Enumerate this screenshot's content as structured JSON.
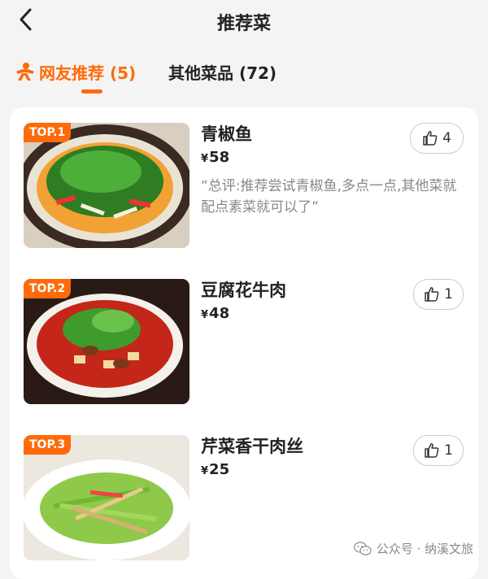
{
  "header": {
    "title": "推荐菜"
  },
  "tabs": [
    {
      "label": "网友推荐 (5)",
      "active": true
    },
    {
      "label": "其他菜品 (72)",
      "active": false
    }
  ],
  "colors": {
    "accent": "#ff6a0a",
    "text": "#222222",
    "muted": "#888888"
  },
  "dishes": [
    {
      "rank": "TOP.1",
      "name": "青椒鱼",
      "price_symbol": "¥",
      "price": "58",
      "likes": "4",
      "comment": "“总评:推荐尝试青椒鱼,多点一点,其他菜就配点素菜就可以了”"
    },
    {
      "rank": "TOP.2",
      "name": "豆腐花牛肉",
      "price_symbol": "¥",
      "price": "48",
      "likes": "1",
      "comment": ""
    },
    {
      "rank": "TOP.3",
      "name": "芹菜香干肉丝",
      "price_symbol": "¥",
      "price": "25",
      "likes": "1",
      "comment": ""
    }
  ],
  "watermark": {
    "text": "公众号 · 纳溪文旅",
    "icon": "wechat-icon"
  },
  "icons": {
    "back": "chevron-left-icon",
    "tab": "people-icon",
    "like": "thumbs-up-icon"
  }
}
